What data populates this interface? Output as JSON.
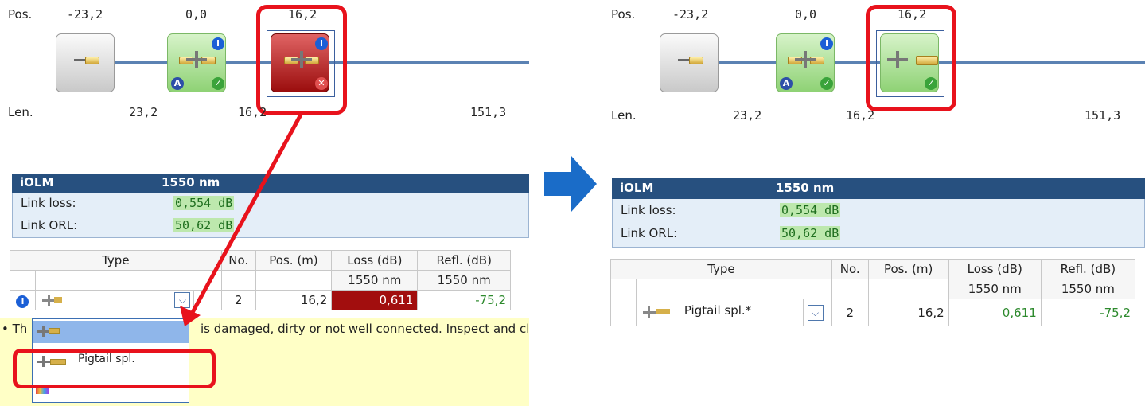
{
  "left": {
    "pos_label": "Pos.",
    "len_label": "Len.",
    "positions": [
      "-23,2",
      "0,0",
      "16,2"
    ],
    "lengths": [
      "23,2",
      "16,2",
      "151,3"
    ],
    "summary": {
      "title": "iOLM",
      "wavelength": "1550 nm",
      "link_loss_label": "Link loss:",
      "link_loss_value": "0,554 dB",
      "link_orl_label": "Link ORL:",
      "link_orl_value": "50,62 dB"
    },
    "table": {
      "headers": [
        "Type",
        "No.",
        "Pos. (m)",
        "Loss (dB)",
        "Refl. (dB)"
      ],
      "subheaders": [
        "",
        "",
        "",
        "1550 nm",
        "1550 nm"
      ],
      "row": {
        "no": "2",
        "pos": "16,2",
        "loss": "0,611",
        "refl": "-75,2"
      }
    },
    "message": "• The connector is damaged, dirty or not well connected. Inspect and cl",
    "message_visible_a": "• Th",
    "message_visible_b": "is damaged, dirty or not well connected. Inspect and cl",
    "dropdown_option": "Pigtail spl.",
    "colors": {
      "fail": "#9b0d0d",
      "pass": "#8fd275",
      "highlight": "#e8121c",
      "header": "#27507f"
    }
  },
  "right": {
    "pos_label": "Pos.",
    "len_label": "Len.",
    "positions": [
      "-23,2",
      "0,0",
      "16,2"
    ],
    "lengths": [
      "23,2",
      "16,2",
      "151,3"
    ],
    "summary": {
      "title": "iOLM",
      "wavelength": "1550 nm",
      "link_loss_label": "Link loss:",
      "link_loss_value": "0,554 dB",
      "link_orl_label": "Link ORL:",
      "link_orl_value": "50,62 dB"
    },
    "table": {
      "headers": [
        "Type",
        "No.",
        "Pos. (m)",
        "Loss (dB)",
        "Refl. (dB)"
      ],
      "subheaders": [
        "",
        "",
        "",
        "1550 nm",
        "1550 nm"
      ],
      "row": {
        "type": "Pigtail spl.*",
        "no": "2",
        "pos": "16,2",
        "loss": "0,611",
        "refl": "-75,2"
      }
    }
  },
  "icons": {
    "info": "i",
    "ok": "✓",
    "fail": "✕",
    "auto": "A",
    "chevron": "⌵"
  }
}
